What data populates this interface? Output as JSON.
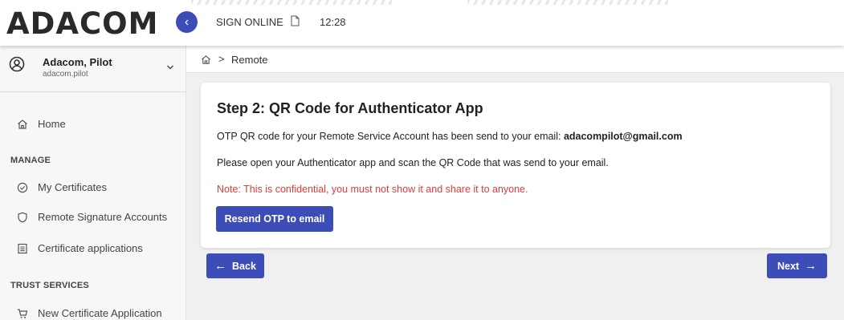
{
  "header": {
    "logo": "ADACOM",
    "title": "SIGN ONLINE",
    "time": "12:28",
    "collapse_glyph": "‹"
  },
  "sidebar": {
    "user": {
      "name": "Adacom, Pilot",
      "login": "adacom.pilot"
    },
    "home": "Home",
    "sections": [
      {
        "title": "MANAGE",
        "items": [
          {
            "label": "My Certificates",
            "icon": "check-circle-icon"
          },
          {
            "label": "Remote Signature Accounts",
            "icon": "shield-icon"
          },
          {
            "label": "Certificate applications",
            "icon": "document-list-icon"
          }
        ]
      },
      {
        "title": "TRUST SERVICES",
        "items": [
          {
            "label": "New Certificate Application",
            "icon": "cart-icon"
          }
        ]
      }
    ]
  },
  "breadcrumb": {
    "separator": ">",
    "current": "Remote"
  },
  "card": {
    "title": "Step 2: QR Code for Authenticator App",
    "line1_text": "OTP QR code for your Remote Service Account has been send to your email: ",
    "line1_email": "adacompilot@gmail.com",
    "line2": "Please open your Authenticator app and scan the QR Code that was send to your email.",
    "note": "Note: This is confidential, you must not show it and share it to anyone.",
    "resend_label": "Resend OTP to email"
  },
  "nav": {
    "back_label": "Back",
    "back_arrow": "←",
    "next_label": "Next",
    "next_arrow": "→"
  },
  "colors": {
    "accent": "#3d4db7",
    "note": "#e53935"
  }
}
